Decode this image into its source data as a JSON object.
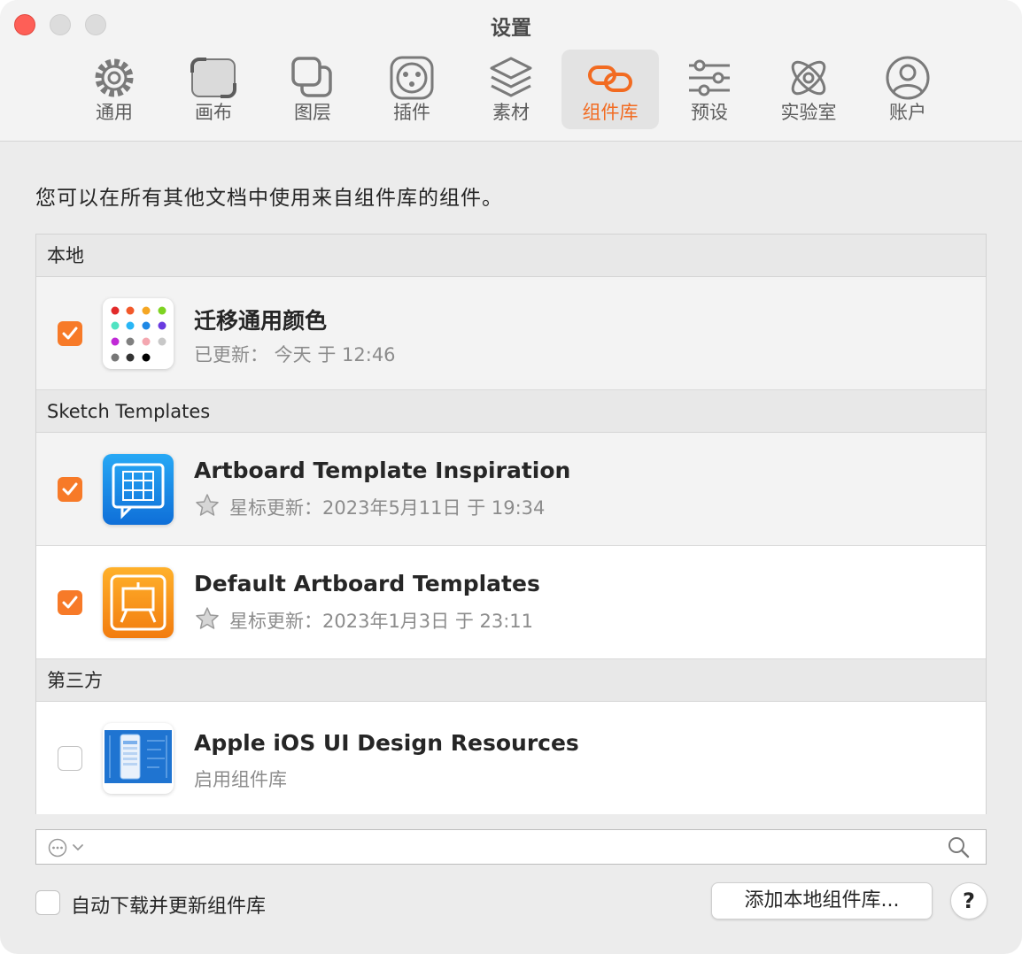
{
  "window": {
    "title": "设置"
  },
  "tabs": [
    {
      "label": "通用",
      "icon": "gear-icon"
    },
    {
      "label": "画布",
      "icon": "canvas-icon"
    },
    {
      "label": "图层",
      "icon": "layers-icon"
    },
    {
      "label": "插件",
      "icon": "plugin-icon"
    },
    {
      "label": "素材",
      "icon": "assets-icon"
    },
    {
      "label": "组件库",
      "icon": "link-icon",
      "active": true
    },
    {
      "label": "预设",
      "icon": "sliders-icon"
    },
    {
      "label": "实验室",
      "icon": "flask-icon"
    },
    {
      "label": "账户",
      "icon": "account-icon"
    }
  ],
  "description": "您可以在所有其他文档中使用来自组件库的组件。",
  "sections": {
    "local": {
      "header": "本地"
    },
    "templates": {
      "header": "Sketch Templates"
    },
    "third_party": {
      "header": "第三方"
    }
  },
  "libraries": [
    {
      "title": "迁移通用颜色",
      "subtitle": "已更新： 今天 于 12:46",
      "checked": true,
      "starred": false
    },
    {
      "title": "Artboard Template Inspiration",
      "subtitle": "星标更新：2023年5月11日 于 19:34",
      "checked": true,
      "starred": true
    },
    {
      "title": "Default Artboard Templates",
      "subtitle": "星标更新：2023年1月3日 于 23:11",
      "checked": true,
      "starred": true
    },
    {
      "title": "Apple iOS UI Design Resources",
      "subtitle": "启用组件库",
      "checked": false,
      "starred": false
    }
  ],
  "footer": {
    "auto_update_label": "自动下载并更新组件库",
    "auto_update_checked": false,
    "add_button": "添加本地组件库...",
    "help_button": "?"
  },
  "colors": {
    "accent": "#f26b21",
    "checkbox": "#f77a28"
  }
}
